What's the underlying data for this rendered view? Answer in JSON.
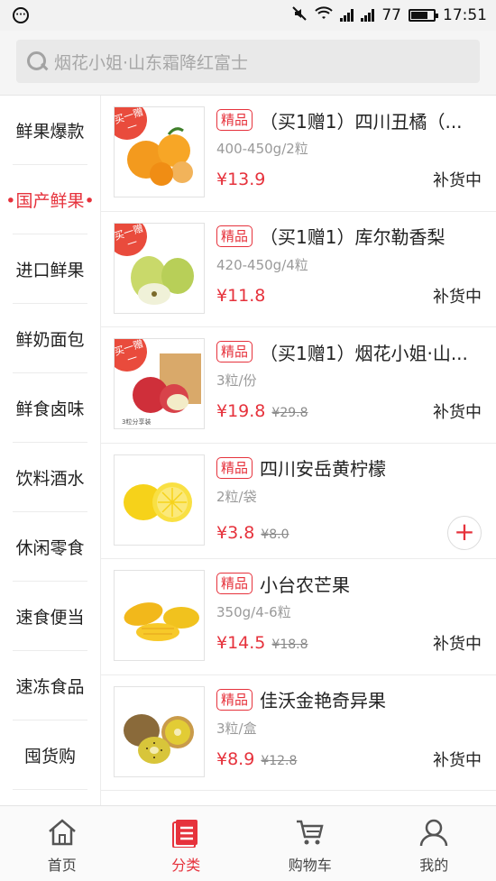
{
  "status_bar": {
    "battery": "77",
    "time": "17:51"
  },
  "search": {
    "placeholder": "烟花小姐·山东霜降红富士"
  },
  "sidebar": {
    "items": [
      {
        "label": "鲜果爆款"
      },
      {
        "label": "•国产鲜果•"
      },
      {
        "label": "进口鲜果"
      },
      {
        "label": "鲜奶面包"
      },
      {
        "label": "鲜食卤味"
      },
      {
        "label": "饮料酒水"
      },
      {
        "label": "休闲零食"
      },
      {
        "label": "速食便当"
      },
      {
        "label": "速冻食品"
      },
      {
        "label": "囤货购"
      }
    ],
    "active_index": 1
  },
  "products": [
    {
      "badge": "精品",
      "title": "（买1赠1）四川丑橘（...",
      "spec": "400-450g/2粒",
      "price": "¥13.9",
      "old_price": "",
      "status": "补货中",
      "promo": "买一赠一",
      "image": "orange"
    },
    {
      "badge": "精品",
      "title": "（买1赠1）库尔勒香梨",
      "spec": "420-450g/4粒",
      "price": "¥11.8",
      "old_price": "",
      "status": "补货中",
      "promo": "买一赠一",
      "image": "pear"
    },
    {
      "badge": "精品",
      "title": "（买1赠1）烟花小姐·山...",
      "spec": "3粒/份",
      "price": "¥19.8",
      "old_price": "¥29.8",
      "status": "补货中",
      "promo": "买一赠一",
      "image": "apple"
    },
    {
      "badge": "精品",
      "title": "四川安岳黄柠檬",
      "spec": "2粒/袋",
      "price": "¥3.8",
      "old_price": "¥8.0",
      "status": "",
      "add_label": "+",
      "image": "lemon"
    },
    {
      "badge": "精品",
      "title": "小台农芒果",
      "spec": "350g/4-6粒",
      "price": "¥14.5",
      "old_price": "¥18.8",
      "status": "补货中",
      "image": "mango"
    },
    {
      "badge": "精品",
      "title": "佳沃金艳奇异果",
      "spec": "3粒/盒",
      "price": "¥8.9",
      "old_price": "¥12.8",
      "status": "补货中",
      "image": "kiwi"
    }
  ],
  "tabbar": {
    "items": [
      {
        "label": "首页",
        "icon": "home-icon"
      },
      {
        "label": "分类",
        "icon": "category-icon"
      },
      {
        "label": "购物车",
        "icon": "cart-icon"
      },
      {
        "label": "我的",
        "icon": "user-icon"
      }
    ],
    "active_index": 1
  },
  "colors": {
    "accent": "#e6323c"
  }
}
